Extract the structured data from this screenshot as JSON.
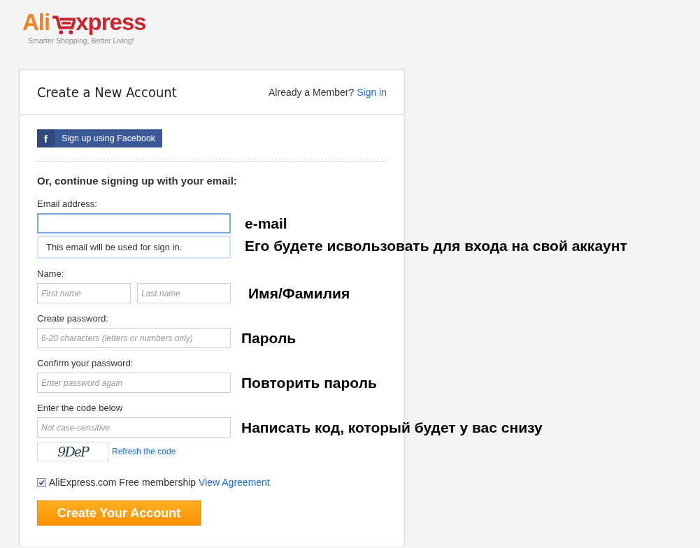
{
  "logo": {
    "brand_start": "Ali",
    "brand_end": "xpress",
    "tagline": "Smarter Shopping, Better Living!"
  },
  "header": {
    "title": "Create a New Account",
    "member_prompt": "Already a Member?",
    "sign_in_link": "Sign in"
  },
  "facebook_button": {
    "icon": "f",
    "label": "Sign up using Facebook"
  },
  "email_section_title": "Or, continue signing up with your email:",
  "fields": [
    {
      "kind": "single",
      "label": "Email address:",
      "focused": true,
      "annotation": "e-mail",
      "hint": "This email will be used for sign in.",
      "hint_annotation": "Его будете исвользовать для входа на свой аккаунт"
    },
    {
      "kind": "pair",
      "label": "Name:",
      "focused": false,
      "inputs": [
        {
          "placeholder": "First name"
        },
        {
          "placeholder": "Last name"
        }
      ],
      "annotation": "Имя/Фамилия"
    },
    {
      "kind": "single",
      "label": "Create password:",
      "focused": false,
      "inputs": [
        {
          "placeholder": "6-20 characters (letters or numbers only)"
        }
      ],
      "annotation": "Пароль"
    },
    {
      "kind": "single",
      "label": "Confirm your password:",
      "focused": false,
      "inputs": [
        {
          "placeholder": "Enter password again"
        }
      ],
      "annotation": "Повторить пароль"
    },
    {
      "kind": "single",
      "label": "Enter the code below",
      "focused": false,
      "inputs": [
        {
          "placeholder": "Not case-sensitive"
        }
      ],
      "annotation": "Написать код, который будет у вас снизу"
    }
  ],
  "captcha": {
    "code": "9DeP",
    "refresh_link": "Refresh the code"
  },
  "agreement": {
    "checked": true,
    "text": "AliExpress.com Free membership",
    "link": "View Agreement"
  },
  "submit_button": "Create Your Account"
}
